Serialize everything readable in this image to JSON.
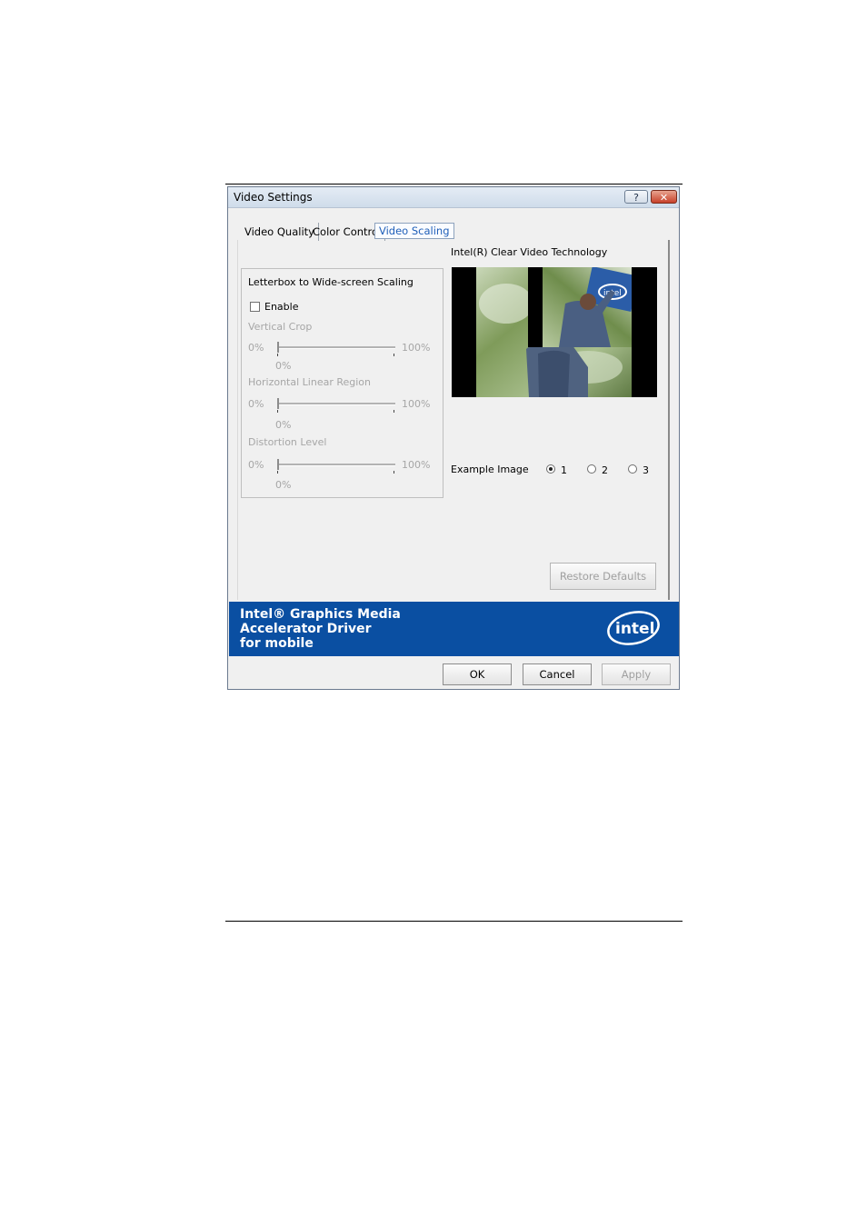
{
  "window": {
    "title": "Video Settings",
    "help_glyph": "?",
    "close_glyph": "✕"
  },
  "tabs": [
    {
      "label": "Video Quality",
      "active": false
    },
    {
      "label": "Color Control",
      "active": false
    },
    {
      "label": "Video Scaling",
      "active": true
    }
  ],
  "scaling": {
    "group_title": "Letterbox to Wide-screen Scaling",
    "enable_label": "Enable",
    "enable_checked": false,
    "sliders": [
      {
        "label": "Vertical Crop",
        "min_label": "0%",
        "max_label": "100%",
        "value_label": "0%",
        "value": 0
      },
      {
        "label": "Horizontal Linear Region",
        "min_label": "0%",
        "max_label": "100%",
        "value_label": "0%",
        "value": 0
      },
      {
        "label": "Distortion Level",
        "min_label": "0%",
        "max_label": "100%",
        "value_label": "0%",
        "value": 0
      }
    ]
  },
  "preview": {
    "title": "Intel(R) Clear Video Technology",
    "logo_text": "intel"
  },
  "example": {
    "label": "Example Image",
    "options": [
      "1",
      "2",
      "3"
    ],
    "selected": "1"
  },
  "restore_defaults_label": "Restore Defaults",
  "banner": {
    "line1": "Intel® Graphics Media",
    "line2": "Accelerator Driver",
    "line3": "for mobile",
    "logo_text": "intel"
  },
  "buttons": {
    "ok": "OK",
    "cancel": "Cancel",
    "apply": "Apply"
  },
  "colors": {
    "banner_blue": "#0a4fa2",
    "active_tab_text": "#1f5fb8",
    "disabled_text": "#a6a6a6"
  }
}
